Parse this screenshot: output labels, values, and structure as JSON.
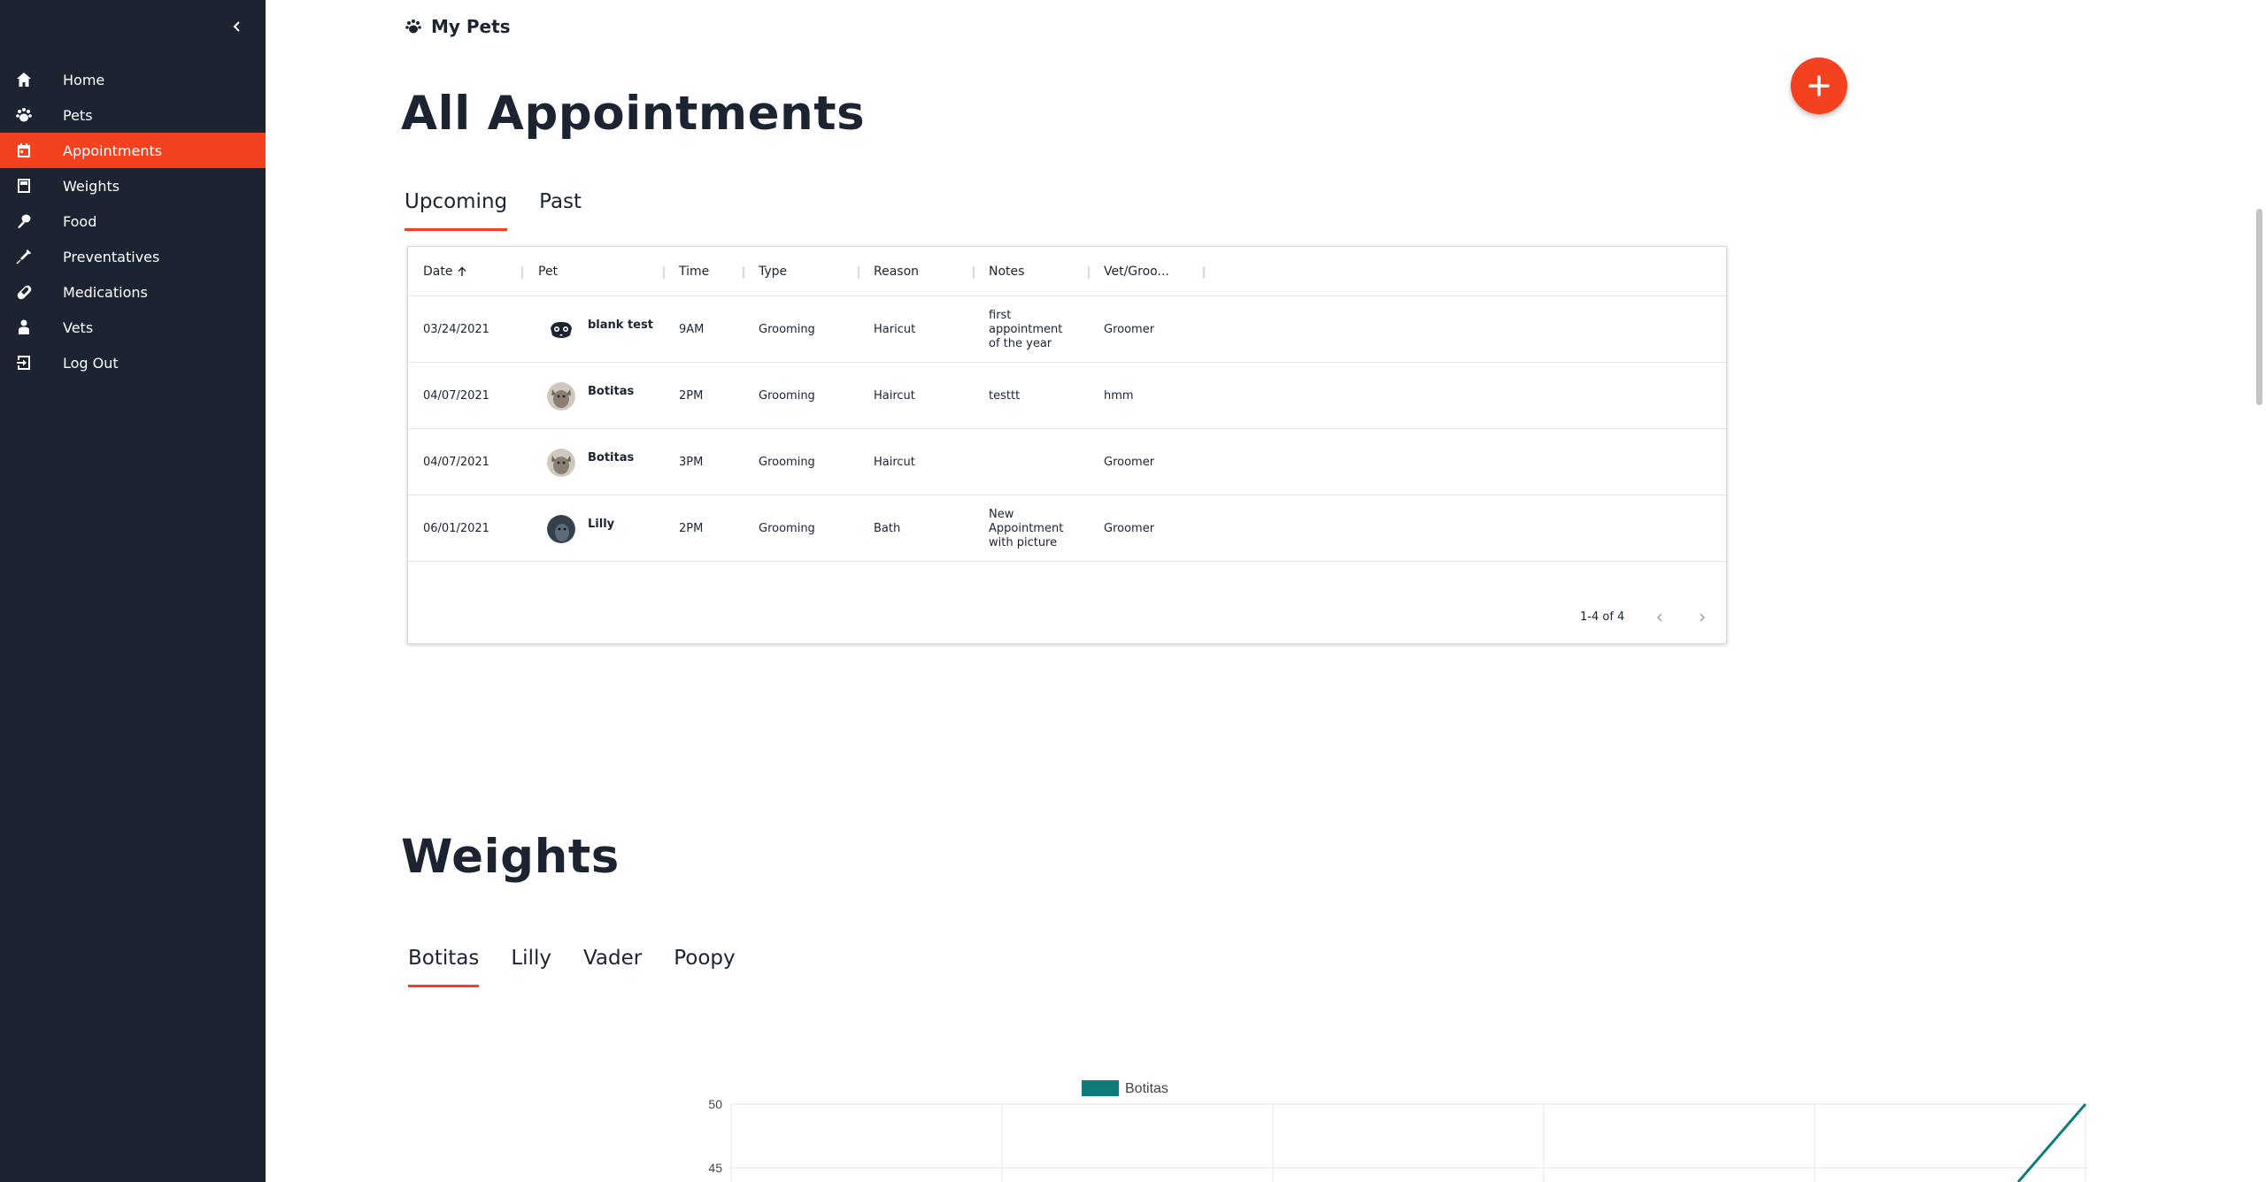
{
  "sidebar": {
    "items": [
      {
        "label": "Home",
        "icon": "home-icon"
      },
      {
        "label": "Pets",
        "icon": "paw-icon"
      },
      {
        "label": "Appointments",
        "icon": "calendar-icon",
        "active": true
      },
      {
        "label": "Weights",
        "icon": "scale-icon"
      },
      {
        "label": "Food",
        "icon": "food-icon"
      },
      {
        "label": "Preventatives",
        "icon": "syringe-icon"
      },
      {
        "label": "Medications",
        "icon": "pill-icon"
      },
      {
        "label": "Vets",
        "icon": "vet-icon"
      },
      {
        "label": "Log Out",
        "icon": "logout-icon"
      }
    ]
  },
  "header": {
    "brand": "My Pets"
  },
  "appointments": {
    "title": "All Appointments",
    "tabs": [
      {
        "label": "Upcoming",
        "active": true
      },
      {
        "label": "Past"
      }
    ],
    "columns": [
      "Date",
      "Pet",
      "Time",
      "Type",
      "Reason",
      "Notes",
      "Vet/Groo..."
    ],
    "rows": [
      {
        "date": "03/24/2021",
        "pet": "blank test",
        "time": "9AM",
        "type": "Grooming",
        "reason": "Haricut",
        "notes": "first appointment of the year",
        "vet": "Groomer"
      },
      {
        "date": "04/07/2021",
        "pet": "Botitas",
        "time": "2PM",
        "type": "Grooming",
        "reason": "Haircut",
        "notes": "testtt",
        "vet": "hmm"
      },
      {
        "date": "04/07/2021",
        "pet": "Botitas",
        "time": "3PM",
        "type": "Grooming",
        "reason": "Haircut",
        "notes": "",
        "vet": "Groomer"
      },
      {
        "date": "06/01/2021",
        "pet": "Lilly",
        "time": "2PM",
        "type": "Grooming",
        "reason": "Bath",
        "notes": "New Appointment with picture",
        "vet": "Groomer"
      }
    ],
    "pagination": "1-4 of 4"
  },
  "weights": {
    "title": "Weights",
    "tabs": [
      {
        "label": "Botitas",
        "active": true
      },
      {
        "label": "Lilly"
      },
      {
        "label": "Vader"
      },
      {
        "label": "Poopy"
      }
    ]
  },
  "chart_data": {
    "type": "line",
    "series": [
      {
        "name": "Botitas",
        "color": "#0f7b7b"
      }
    ],
    "y_ticks": [
      50,
      45
    ],
    "legend_position": "top-center",
    "grid": true
  },
  "colors": {
    "accent": "#f4411f",
    "sidebar": "#1b2430",
    "series": "#0f7b7b"
  }
}
